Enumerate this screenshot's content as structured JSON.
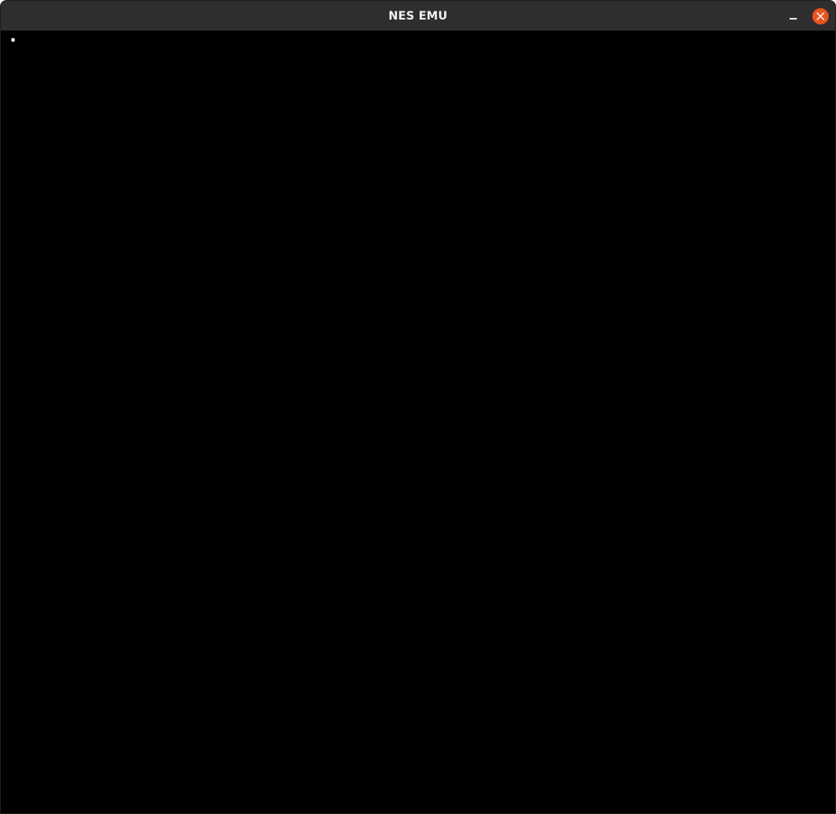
{
  "window": {
    "title": "NES EMU",
    "minimize_icon": "minimize-icon",
    "close_icon": "close-icon"
  },
  "colors": {
    "titlebar": "#2f2d2d",
    "title_text": "#f2f2f2",
    "close_button": "#e95420",
    "screen": "#000000",
    "pixel": "#ffffff"
  }
}
